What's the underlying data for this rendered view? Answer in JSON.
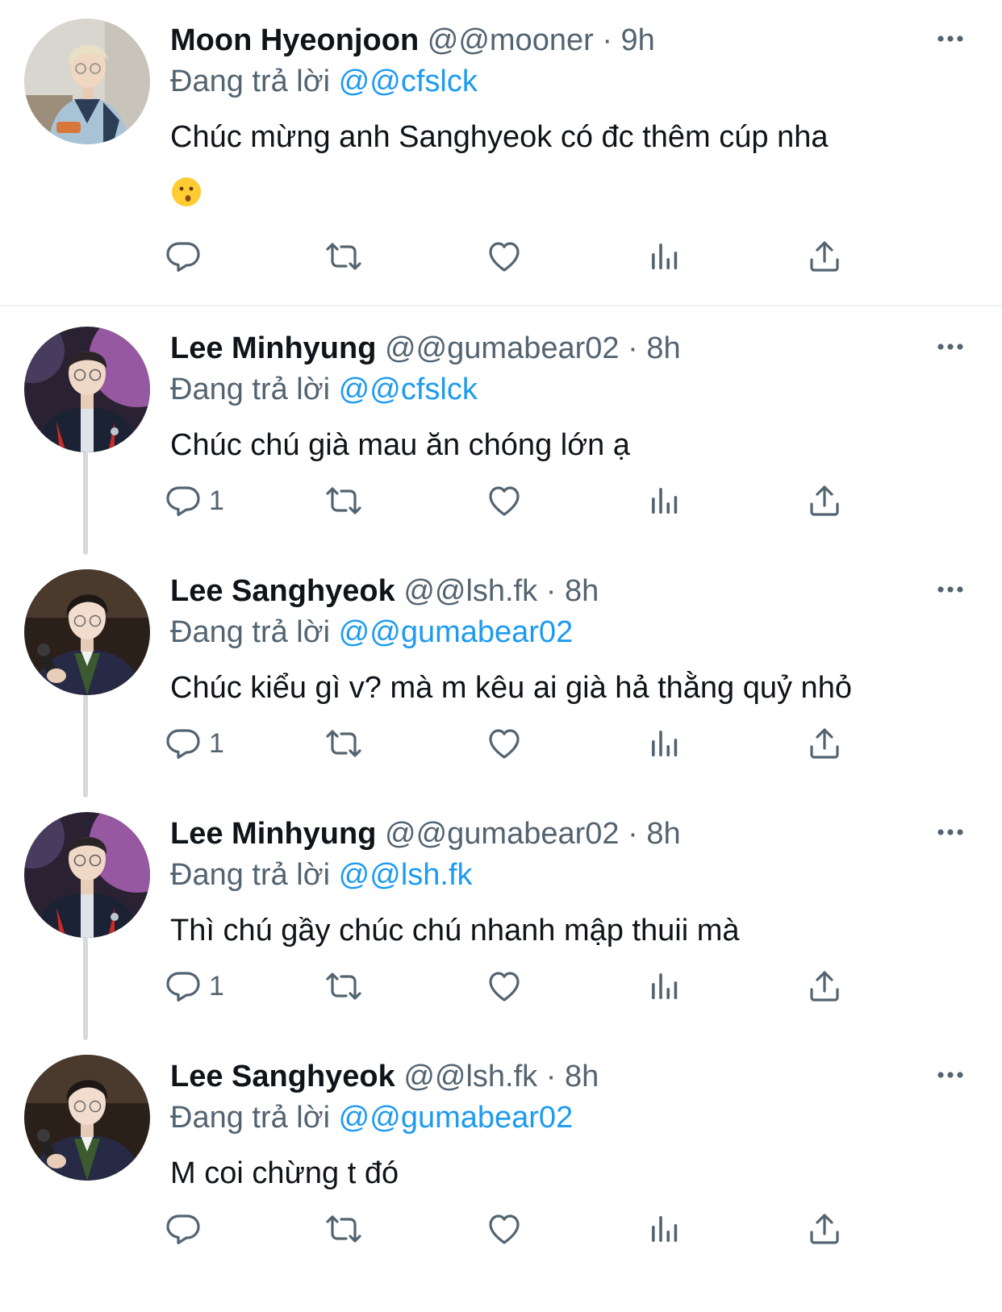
{
  "reply_prefix": "Đang trả lời",
  "tweets": [
    {
      "name": "Moon Hyeonjoon",
      "handle": "@@mooner",
      "time": "9h",
      "reply_to": "@@cfslck",
      "text": "Chúc mừng anh Sanghyeok có đc thêm cúp nha",
      "emoji": "kissing-face",
      "reply_count": "",
      "avatar": "avatar-mooner"
    },
    {
      "name": "Lee Minhyung",
      "handle": "@@gumabear02",
      "time": "8h",
      "reply_to": "@@cfslck",
      "text": "Chúc chú già mau ăn chóng lớn ạ",
      "reply_count": "1",
      "avatar": "avatar-gumabear"
    },
    {
      "name": "Lee Sanghyeok",
      "handle": "@@lsh.fk",
      "time": "8h",
      "reply_to": "@@gumabear02",
      "text": "Chúc kiểu gì v? mà m kêu ai già hả thằng quỷ nhỏ",
      "reply_count": "1",
      "avatar": "avatar-lsh"
    },
    {
      "name": "Lee Minhyung",
      "handle": "@@gumabear02",
      "time": "8h",
      "reply_to": "@@lsh.fk",
      "text": "Thì chú gầy chúc chú nhanh mập thuii mà",
      "reply_count": "1",
      "avatar": "avatar-gumabear"
    },
    {
      "name": "Lee Sanghyeok",
      "handle": "@@lsh.fk",
      "time": "8h",
      "reply_to": "@@gumabear02",
      "text": "M coi chừng t đó",
      "reply_count": "",
      "avatar": "avatar-lsh"
    }
  ],
  "colors": {
    "link": "#1d9bf0",
    "secondary_text": "#536471",
    "thread_line": "#d7dadd"
  }
}
